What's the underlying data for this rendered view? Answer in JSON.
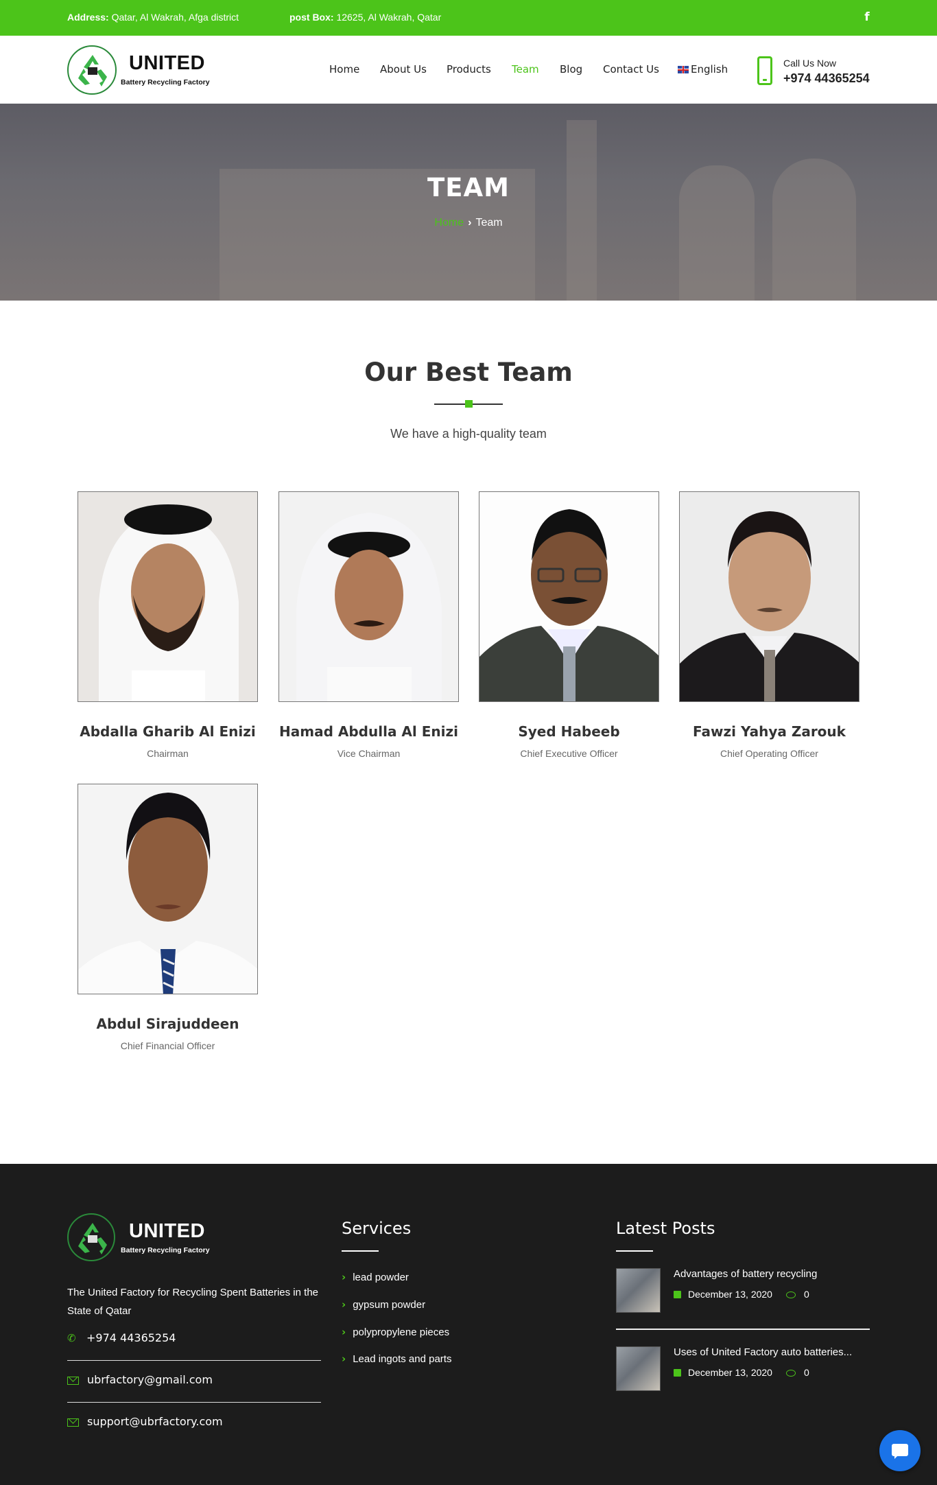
{
  "topbar": {
    "address_label": "Address:",
    "address_value": "Qatar, Al Wakrah, Afga district",
    "pobox_label": "post Box:",
    "pobox_value": "12625, Al Wakrah, Qatar",
    "social_icon": "facebook-icon",
    "social_glyph": "f",
    "bg_color": "#4cc41a"
  },
  "brand": {
    "name": "UNITED",
    "subtitle": "Battery Recycling Factory",
    "accent": "#4cc41a"
  },
  "nav": {
    "items": [
      {
        "label": "Home",
        "active": false
      },
      {
        "label": "About Us",
        "active": false
      },
      {
        "label": "Products",
        "active": false
      },
      {
        "label": "Team",
        "active": true
      },
      {
        "label": "Blog",
        "active": false
      },
      {
        "label": "Contact Us",
        "active": false
      },
      {
        "label": "English",
        "active": false
      }
    ]
  },
  "call": {
    "label": "Call Us Now",
    "number": "+974 44365254"
  },
  "banner": {
    "title": "TEAM",
    "breadcrumb_home": "Home",
    "breadcrumb_sep": "›",
    "breadcrumb_current": "Team"
  },
  "section": {
    "title": "Our Best Team",
    "subtitle": "We have a high-quality team"
  },
  "team": [
    {
      "name": "Abdalla Gharib Al Enizi",
      "role": "Chairman"
    },
    {
      "name": "Hamad Abdulla Al Enizi",
      "role": "Vice Chairman"
    },
    {
      "name": "Syed Habeeb",
      "role": "Chief Executive Officer"
    },
    {
      "name": "Fawzi Yahya Zarouk",
      "role": "Chief Operating Officer"
    },
    {
      "name": "Abdul Sirajuddeen",
      "role": "Chief Financial Officer"
    }
  ],
  "footer": {
    "description": "The United Factory for Recycling Spent Batteries in the State of Qatar",
    "phone": "+974 44365254",
    "email1": "ubrfactory@gmail.com",
    "email2": "support@ubrfactory.com",
    "services_title": "Services",
    "services": [
      "lead powder",
      "gypsum powder",
      "polypropylene pieces",
      "Lead ingots and parts"
    ],
    "posts_title": "Latest Posts",
    "posts": [
      {
        "title": "Advantages of battery recycling",
        "date": "December 13, 2020",
        "comments": "0"
      },
      {
        "title": "Uses of United Factory auto batteries...",
        "date": "December 13, 2020",
        "comments": "0"
      }
    ]
  }
}
